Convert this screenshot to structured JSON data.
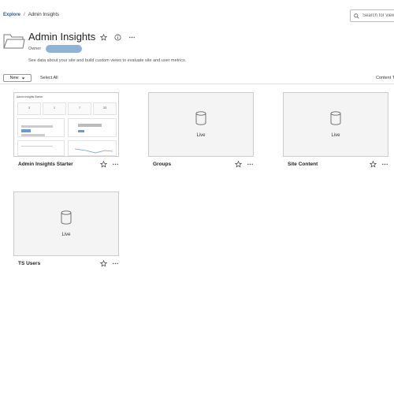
{
  "breadcrumb": {
    "root": "Explore",
    "separator": "/",
    "current": "Admin Insights"
  },
  "search": {
    "placeholder": "Search for views"
  },
  "project": {
    "title": "Admin Insights",
    "owner_label": "Owner",
    "description": "See data about your site and build custom views to evaluate site and user metrics."
  },
  "toolbar": {
    "new_label": "New",
    "select_all_label": "Select All",
    "content_count": "Content Type"
  },
  "cards": [
    {
      "name": "Admin Insights Starter",
      "kind": "workbook"
    },
    {
      "name": "Groups",
      "kind": "datasource",
      "badge": "Live"
    },
    {
      "name": "Site Content",
      "kind": "datasource",
      "badge": "Live"
    },
    {
      "name": "TS Users",
      "kind": "datasource",
      "badge": "Live"
    }
  ],
  "preview": {
    "title": "Admin Insights Starter"
  },
  "colors": {
    "link": "#1f5f8b",
    "owner_pill": "#8fb3d6",
    "border": "#cccccc"
  }
}
